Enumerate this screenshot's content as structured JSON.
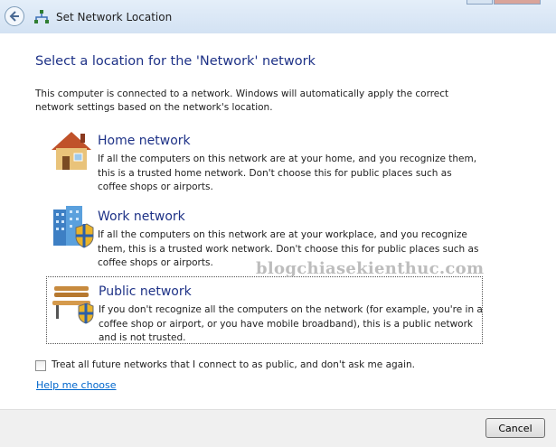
{
  "window": {
    "title": "Set Network Location",
    "back_icon": "back-arrow-icon",
    "title_icon": "network-icon"
  },
  "main": {
    "heading": "Select a location for the 'Network' network",
    "intro": "This computer is connected to a network. Windows will automatically apply the correct network settings based on the network's location."
  },
  "options": [
    {
      "title": "Home network",
      "description": "If all the computers on this network are at your home, and you recognize them, this is a trusted home network.  Don't choose this for public places such as coffee shops or airports.",
      "icon": "house-icon"
    },
    {
      "title": "Work network",
      "description": "If all the computers on this network are at your workplace, and you recognize them, this is a trusted work network.  Don't choose this for public places such as coffee shops or airports.",
      "icon": "office-building-icon"
    },
    {
      "title": "Public network",
      "description": "If you don't recognize all the computers on the network (for example, you're in a coffee shop or airport, or you have mobile broadband), this is a public network and is not trusted.",
      "icon": "park-bench-icon",
      "selected": true
    }
  ],
  "checkbox": {
    "label": "Treat all future networks that I connect to as public, and don't ask me again.",
    "checked": false
  },
  "help_link": "Help me choose",
  "footer": {
    "cancel_label": "Cancel"
  },
  "watermark": "blogchiasekienthuc.com",
  "colors": {
    "heading": "#1e3287",
    "link": "#0066cc"
  }
}
